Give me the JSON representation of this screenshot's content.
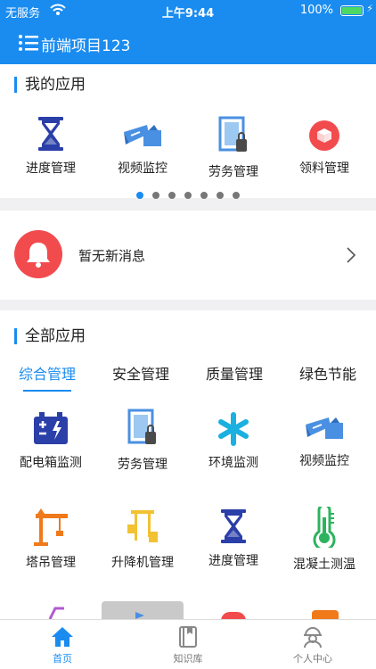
{
  "status_bar": {
    "carrier": "无服务",
    "time": "上午9:44",
    "battery": "100%"
  },
  "nav": {
    "title": "前端项目123"
  },
  "my_apps": {
    "title": "我的应用",
    "items": [
      {
        "label": "进度管理",
        "icon": "hourglass-icon"
      },
      {
        "label": "视频监控",
        "icon": "camera-icon"
      },
      {
        "label": "劳务管理",
        "icon": "door-icon"
      },
      {
        "label": "领料管理",
        "icon": "materials-icon"
      }
    ],
    "page_count": 7,
    "active_page": 1
  },
  "message": {
    "text": "暂无新消息"
  },
  "all_apps": {
    "title": "全部应用",
    "tabs": [
      "综合管理",
      "安全管理",
      "质量管理",
      "绿色节能"
    ],
    "active_tab": 0,
    "items": [
      {
        "label": "配电箱监测",
        "icon": "battery-box-icon"
      },
      {
        "label": "劳务管理",
        "icon": "door-icon"
      },
      {
        "label": "环境监测",
        "icon": "asterisk-icon"
      },
      {
        "label": "视频监控",
        "icon": "camera-icon"
      },
      {
        "label": "塔吊管理",
        "icon": "tower-crane-icon"
      },
      {
        "label": "升降机管理",
        "icon": "elevator-icon"
      },
      {
        "label": "进度管理",
        "icon": "hourglass-icon"
      },
      {
        "label": "混凝土测温",
        "icon": "thermometer-icon"
      }
    ]
  },
  "bottom_nav": {
    "items": [
      {
        "label": "首页",
        "icon": "home-icon"
      },
      {
        "label": "知识库",
        "icon": "book-icon"
      },
      {
        "label": "个人中心",
        "icon": "worker-icon"
      }
    ],
    "active": 0
  },
  "colors": {
    "accent": "#1a8cf0",
    "red": "#f24b4e",
    "navy": "#2b3fa8",
    "orange": "#f07a1a",
    "yellow": "#f2c233",
    "green": "#2db35e"
  }
}
